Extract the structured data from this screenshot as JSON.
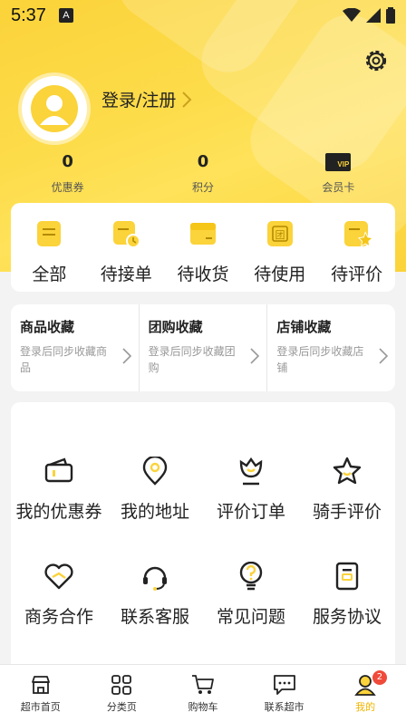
{
  "status": {
    "time": "5:37",
    "indicator": "A"
  },
  "header": {
    "login_label": "登录/注册"
  },
  "stats": [
    {
      "value": "0",
      "label": "优惠券"
    },
    {
      "value": "0",
      "label": "积分"
    },
    {
      "value": "",
      "label": "会员卡",
      "icon": "vip-card-icon",
      "icon_text": "VIP"
    }
  ],
  "orders": [
    {
      "label": "全部",
      "icon": "all-orders-icon"
    },
    {
      "label": "待接单",
      "icon": "pending-accept-icon"
    },
    {
      "label": "待收货",
      "icon": "pending-receive-icon"
    },
    {
      "label": "待使用",
      "icon": "pending-use-icon",
      "icon_text": "团"
    },
    {
      "label": "待评价",
      "icon": "pending-review-icon"
    }
  ],
  "favorites": [
    {
      "title": "商品收藏",
      "desc": "登录后同步收藏商品"
    },
    {
      "title": "团购收藏",
      "desc": "登录后同步收藏团购"
    },
    {
      "title": "店铺收藏",
      "desc": "登录后同步收藏店铺"
    }
  ],
  "services": [
    {
      "label": "我的优惠券",
      "icon": "coupon-icon"
    },
    {
      "label": "我的地址",
      "icon": "location-icon"
    },
    {
      "label": "评价订单",
      "icon": "review-order-icon"
    },
    {
      "label": "骑手评价",
      "icon": "star-icon"
    },
    {
      "label": "商务合作",
      "icon": "handshake-icon"
    },
    {
      "label": "联系客服",
      "icon": "headset-icon"
    },
    {
      "label": "常见问题",
      "icon": "faq-icon"
    },
    {
      "label": "服务协议",
      "icon": "agreement-icon"
    }
  ],
  "tabbar": [
    {
      "label": "超市首页",
      "icon": "store-icon",
      "active": false
    },
    {
      "label": "分类页",
      "icon": "category-icon",
      "active": false
    },
    {
      "label": "购物车",
      "icon": "cart-icon",
      "active": false
    },
    {
      "label": "联系超市",
      "icon": "chat-icon",
      "active": false
    },
    {
      "label": "我的",
      "icon": "user-icon",
      "active": true,
      "badge": "2"
    }
  ],
  "colors": {
    "brand": "#fbd33a",
    "accent": "#f0b400",
    "badge": "#f04a3a"
  }
}
